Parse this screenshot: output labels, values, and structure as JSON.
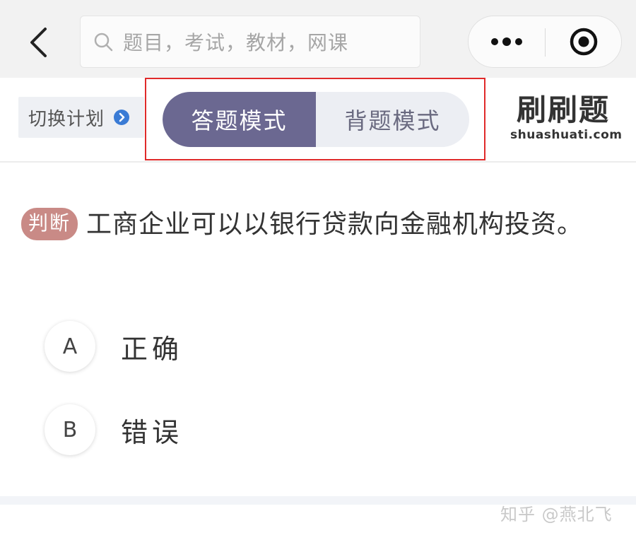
{
  "nav": {
    "back_icon": "chevron-left-icon",
    "search_placeholder": "题目，考试，教材，网课",
    "search_icon": "search-icon",
    "more_icon": "more-dots-icon",
    "close_icon": "target-close-icon"
  },
  "mode_bar": {
    "switch_plan_label": "切换计划",
    "switch_plan_icon": "chevron-right-circle-icon",
    "modes": [
      "答题模式",
      "背题模式"
    ],
    "active_mode": "答题模式",
    "brand_cn": "刷刷题",
    "brand_en": "shuashuati.com"
  },
  "question": {
    "type_badge": "判断",
    "text": "工商企业可以以银行贷款向金融机构投资。",
    "options": [
      {
        "letter": "A",
        "text": "正确"
      },
      {
        "letter": "B",
        "text": "错误"
      }
    ]
  },
  "footer": {
    "watermark": "知乎 @燕北飞"
  },
  "colors": {
    "active_mode_bg": "#6b6891",
    "toggle_bg": "#eceef3",
    "badge_bg": "#c98a86",
    "highlight_border": "#e02a2a",
    "topbar_bg": "#f2f2f2"
  }
}
